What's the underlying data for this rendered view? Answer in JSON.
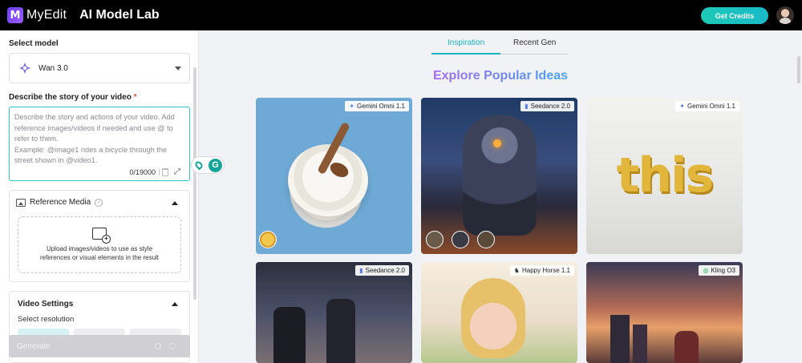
{
  "header": {
    "brand": "MyEdit",
    "logo_letter": "M",
    "app_title": "AI Model Lab",
    "get_credits_label": "Get Credits"
  },
  "sidebar": {
    "select_model_label": "Select model",
    "model_name": "Wan 3.0",
    "story_label": "Describe the story of your video",
    "story_required_mark": "*",
    "story_placeholder": "Describe the story and actions of your video. Add reference images/videos if needed and use @ to refer to them.\nExample: @image1 rides a bicycle through the street shown in @video1.",
    "story_counter": "0/19000",
    "reference_media": {
      "title": "Reference Media",
      "upload_text": "Upload images/videos to use as style references or visual elements in the result"
    },
    "video_settings": {
      "title": "Video Settings",
      "resolution_label": "Select resolution"
    },
    "generate_label": "Generate"
  },
  "main": {
    "tabs": [
      {
        "label": "Inspiration",
        "active": true
      },
      {
        "label": "Recent Gen",
        "active": false
      }
    ],
    "explore_title": "Explore Popular Ideas",
    "cards": [
      {
        "model": "Gemini Omni 1.1",
        "icon": "sparkle-icon"
      },
      {
        "model": "Seedance 2.0",
        "icon": "bars-icon"
      },
      {
        "model": "Gemini Omni 1.1",
        "icon": "sparkle-icon"
      },
      {
        "model": "Seedance 2.0",
        "icon": "bars-icon"
      },
      {
        "model": "Happy Horse 1.1",
        "icon": "horse-icon"
      },
      {
        "model": "Kling O3",
        "icon": "kling-icon"
      }
    ],
    "card3_text": "this"
  },
  "colors": {
    "accent": "#18b4c4",
    "header_bg": "#000000",
    "credits_btn": "#1ec9b6"
  }
}
